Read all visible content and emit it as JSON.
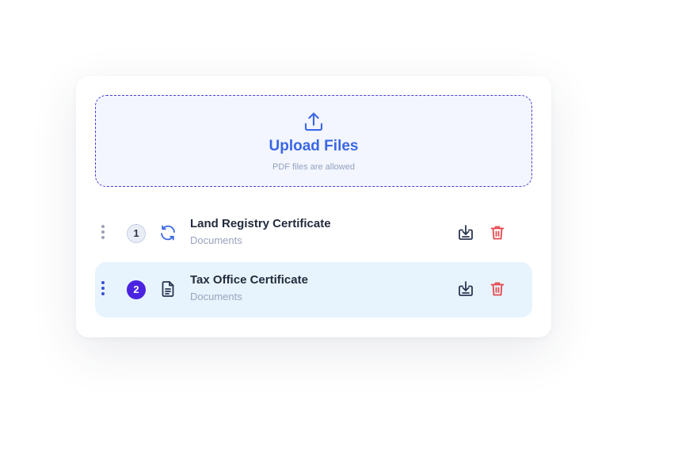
{
  "upload": {
    "title": "Upload Files",
    "hint": "PDF files are allowed"
  },
  "files": [
    {
      "index": "1",
      "name": "Land Registry Certificate",
      "category": "Documents",
      "status_icon": "refresh-icon",
      "state": "uploading"
    },
    {
      "index": "2",
      "name": "Tax Office Certificate",
      "category": "Documents",
      "status_icon": "document-icon",
      "state": "selected"
    }
  ],
  "colors": {
    "accent": "#3b67e6",
    "dashed_border": "#4b3fd6",
    "selected_badge": "#4a22e0",
    "selected_row_bg": "#e8f4fd",
    "delete": "#e5484d",
    "download": "#2a3550"
  }
}
